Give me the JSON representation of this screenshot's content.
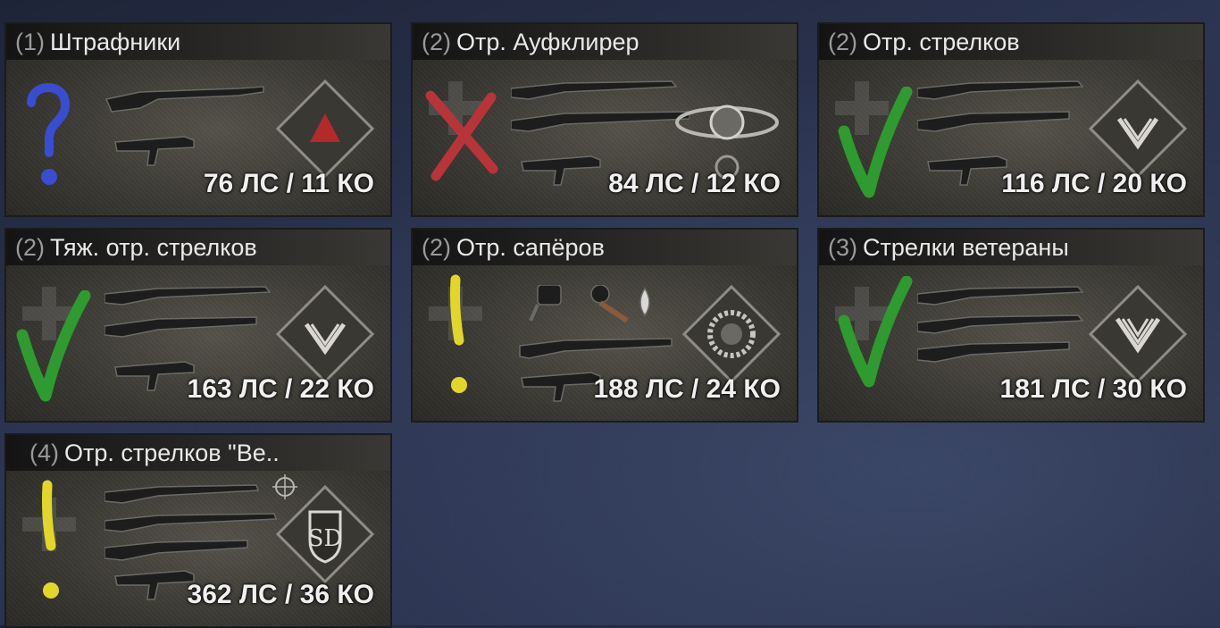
{
  "squads": [
    {
      "count": "(1)",
      "name": "Штрафники",
      "cost": "76 ЛС / 11 КО",
      "mark": "question-blue",
      "badge": "triangle"
    },
    {
      "count": "(2)",
      "name": "Отр. Ауфклирер",
      "cost": "84 ЛС / 12 КО",
      "mark": "x-red",
      "badge": "clasp"
    },
    {
      "count": "(2)",
      "name": "Отр. стрелков",
      "cost": "116 ЛС / 20 КО",
      "mark": "check-green",
      "badge": "chevron2"
    },
    {
      "count": "(2)",
      "name": "Тяж. отр. стрелков",
      "cost": "163 ЛС / 22 КО",
      "mark": "check-green",
      "badge": "chevron2"
    },
    {
      "count": "(2)",
      "name": "Отр. сапёров",
      "cost": "188 ЛС / 24 КО",
      "mark": "exclaim-yellow",
      "badge": "wreath"
    },
    {
      "count": "(3)",
      "name": "Стрелки ветераны",
      "cost": "181 ЛС / 30 КО",
      "mark": "check-green",
      "badge": "chevron3"
    },
    {
      "count": "(4)",
      "name": "Отр. стрелков \"Ве..",
      "cost": "362 ЛС / 36 КО",
      "mark": "exclaim-yellow",
      "badge": "sd"
    }
  ],
  "colors": {
    "check": "#2f9a2f",
    "cross": "#b8343a",
    "question": "#3a4cd0",
    "exclaim": "#e3d62a"
  }
}
